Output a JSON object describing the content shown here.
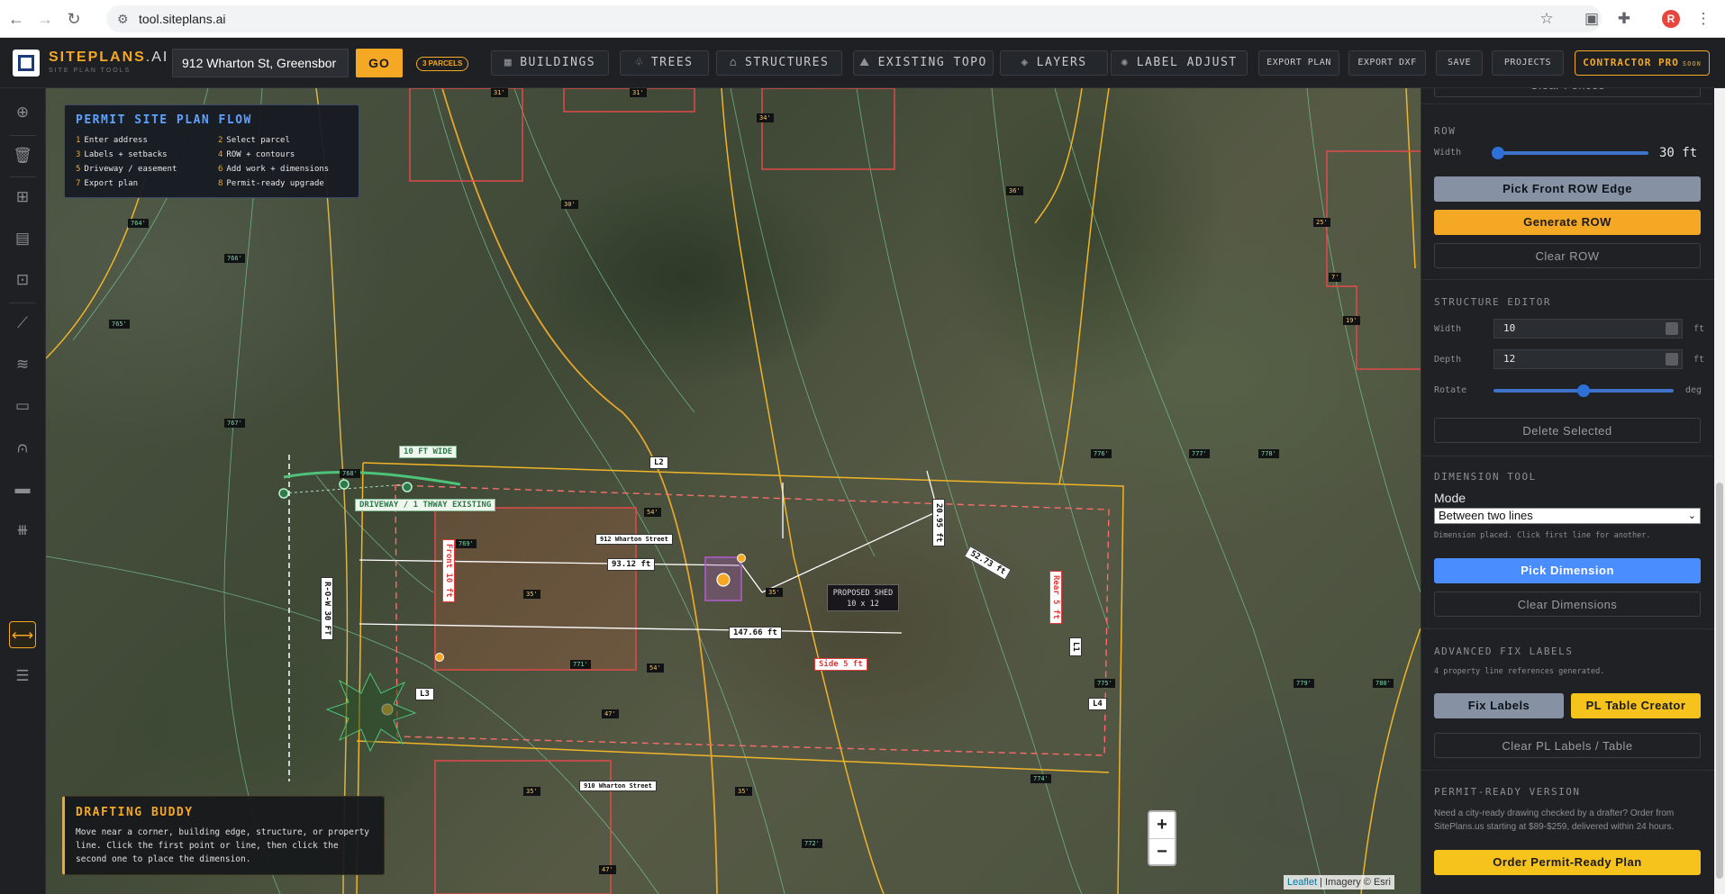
{
  "browser": {
    "url": "tool.siteplans.ai"
  },
  "app": {
    "logo": "SITEPLANS",
    "logo_suffix": ".AI",
    "logo_sub": "SITE PLAN TOOLS",
    "address_value": "912 Wharton St, Greensbor",
    "go_label": "GO",
    "parcels_badge": "3 PARCELS",
    "toolbar": {
      "buildings": "BUILDINGS",
      "trees": "TREES",
      "structures": "STRUCTURES",
      "existing_topo": "EXISTING TOPO",
      "layers": "LAYERS",
      "label_adjust": "LABEL ADJUST",
      "export_plan": "EXPORT PLAN",
      "export_dxf": "EXPORT DXF",
      "save": "SAVE",
      "projects": "PROJECTS",
      "contractor_pro": "CONTRACTOR PRO",
      "soon": "SOON"
    }
  },
  "flow_panel": {
    "title": "PERMIT SITE PLAN FLOW",
    "steps": [
      {
        "n": "1",
        "text": "Enter address"
      },
      {
        "n": "2",
        "text": "Select parcel"
      },
      {
        "n": "3",
        "text": "Labels + setbacks"
      },
      {
        "n": "4",
        "text": "ROW + contours"
      },
      {
        "n": "5",
        "text": "Driveway / easement"
      },
      {
        "n": "6",
        "text": "Add work + dimensions"
      },
      {
        "n": "7",
        "text": "Export plan"
      },
      {
        "n": "8",
        "text": "Permit-ready upgrade"
      }
    ]
  },
  "drafting_buddy": {
    "title": "DRAFTING BUDDY",
    "text": "Move near a corner, building edge, structure, or property line. Click the first point or line, then click the second one to place the dimension."
  },
  "map_labels": {
    "row_width": "10 FT WIDE",
    "driveway": "DRIVEWAY / 1 THWAY EXISTING",
    "row_label": "R-O-W 30 FT",
    "front": "Front 10 ft",
    "rear": "Rear 5 ft",
    "side": "Side 5 ft",
    "dim_93": "93.12 ft",
    "dim_147": "147.66 ft",
    "dim_2095": "20.95 ft",
    "dim_diag": "52.73 ft",
    "house_912": "912 Wharton Street",
    "house_910": "910 Wharton Street",
    "shed_title": "PROPOSED SHED",
    "shed_size": "10 x 12",
    "l1": "L1",
    "l2": "L2",
    "l3": "L3",
    "l4": "L4",
    "edge_54a": "54'",
    "edge_54b": "54'",
    "edge_35a": "35'",
    "edge_35b": "35'",
    "edge_35c": "35'",
    "edge_35d": "35'",
    "edge_47a": "47'",
    "edge_47b": "47'",
    "edge_34": "34'",
    "edge_30": "30'",
    "edge_36": "36'",
    "edge_31a": "31'",
    "edge_31b": "31'",
    "edge_25": "25'",
    "edge_7": "7'",
    "edge_19": "19'",
    "topo_764": "764'",
    "topo_766": "766'",
    "topo_765": "765'",
    "topo_767": "767'",
    "topo_768": "768'",
    "topo_769": "769'",
    "topo_771": "771'",
    "topo_772": "772'",
    "topo_774": "774'",
    "topo_775": "775'",
    "topo_776": "776'",
    "topo_777": "777'",
    "topo_778": "778'",
    "topo_779": "779'",
    "topo_780": "780'"
  },
  "map_controls": {
    "zoom_in": "+",
    "zoom_out": "−",
    "attribution_leaflet": "Leaflet",
    "attribution_rest": "| Imagery © Esri"
  },
  "right_panel": {
    "clear_fences": "Clear Fences",
    "row": {
      "title": "ROW",
      "width_label": "Width",
      "width_value": "30",
      "width_unit": "ft",
      "slider_fraction": 0.03,
      "pick_front": "Pick Front ROW Edge",
      "generate": "Generate ROW",
      "clear": "Clear ROW"
    },
    "structure_editor": {
      "title": "STRUCTURE EDITOR",
      "width_label": "Width",
      "width_value": "10",
      "depth_label": "Depth",
      "depth_value": "12",
      "unit_ft": "ft",
      "rotate_label": "Rotate",
      "rotate_unit": "deg",
      "rotate_fraction": 0.5,
      "delete": "Delete Selected"
    },
    "dimension_tool": {
      "title": "DIMENSION TOOL",
      "mode_label": "Mode",
      "mode_value": "Between two lines",
      "status": "Dimension placed. Click first line for another.",
      "pick": "Pick Dimension",
      "clear": "Clear Dimensions"
    },
    "advanced_fix": {
      "title": "ADVANCED FIX LABELS",
      "note": "4 property line references generated.",
      "fix_labels": "Fix Labels",
      "pl_table": "PL Table Creator",
      "clear": "Clear PL Labels / Table"
    },
    "permit_ready": {
      "title": "PERMIT-READY VERSION",
      "desc": "Need a city-ready drawing checked by a drafter? Order from SitePlans.us starting at $89-$259, delivered within 24 hours.",
      "order": "Order Permit-Ready Plan"
    }
  },
  "colors": {
    "accent": "#f4a824",
    "blue": "#4a8dff",
    "property_line": "#f0b429",
    "building_red": "#e04a4a",
    "contour_green": "#7fd7a6"
  }
}
